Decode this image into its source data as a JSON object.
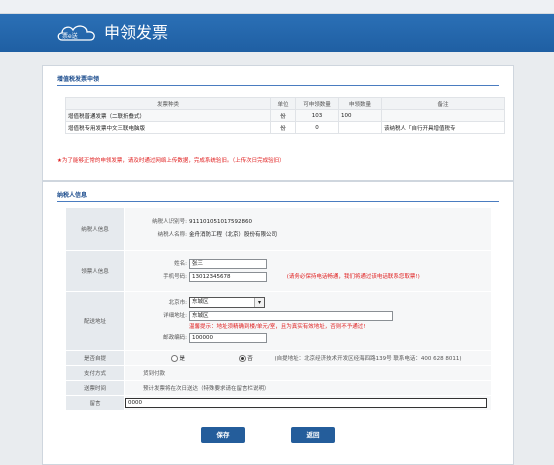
{
  "header": {
    "title": "申领发票",
    "logo_text": "票e送"
  },
  "invoice_section": {
    "title": "增值税发票申领",
    "columns": [
      "发票种类",
      "单位",
      "可申领数量",
      "申领数量",
      "备注"
    ],
    "rows": [
      {
        "type": "增值税普通发票（二联折叠式）",
        "unit": "份",
        "available": "103",
        "requested": "100",
        "note": ""
      },
      {
        "type": "增值税专用发票中文三联电脑版",
        "unit": "份",
        "available": "0",
        "requested": "",
        "note": "该纳税人「自行开具增值税专"
      }
    ],
    "warning": "★为了能够正常的申领发票，请及时通过网络上传数据，完成系统验旧。（上传次日完成验旧）"
  },
  "taxpayer_section": {
    "title": "纳税人信息",
    "taxpayer_info": {
      "label": "纳税人信息",
      "id_label": "纳税人识别号:",
      "id_value": "911101051017592860",
      "name_label": "纳税人名称:",
      "name_value": "金舟消防工程（北京）股份有限公司"
    },
    "collector": {
      "label": "领票人信息",
      "name_label": "姓名:",
      "name_value": "张三",
      "phone_label": "手机号码:",
      "phone_value": "13012345678",
      "phone_hint": "(请务必保持电话畅通，我们将通过该电话联系您取票!)"
    },
    "address": {
      "label": "配送地址",
      "city_label": "北京市:",
      "district_value": "东城区",
      "detail_label": "详细地址:",
      "detail_value": "东城区",
      "warning": "温馨提示：地址须精确到楼/单元/室，且为真实有效地址，否则不予通过!",
      "postal_label": "邮政编码:",
      "postal_value": "100000"
    },
    "self_pickup": {
      "label": "是否自提",
      "yes_label": "是",
      "no_label": "否",
      "selected": "否",
      "note": "(自提地址：北京经济技术开发区经海四路139号 联系电话：400 628 8011)"
    },
    "payment": {
      "label": "支付方式",
      "value": "货到付款"
    },
    "delivery_time": {
      "label": "送票时间",
      "value": "预计发票将在次日送达（特殊要求请在留言栏说明）"
    },
    "message": {
      "label": "留言",
      "value": "0000"
    }
  },
  "buttons": {
    "save": "保存",
    "back": "返回"
  }
}
